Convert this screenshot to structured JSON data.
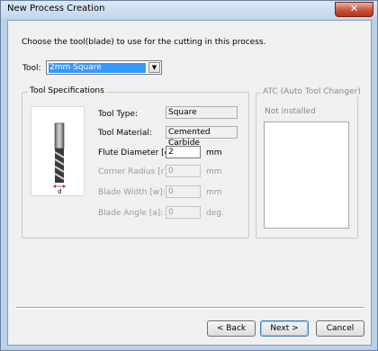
{
  "window": {
    "title": "New Process Creation",
    "close_glyph": "✕"
  },
  "prompt": "Choose the tool(blade) to use for the cutting in this process.",
  "tool": {
    "label": "Tool:",
    "selected": "2mm Square"
  },
  "specs": {
    "group_label": "Tool Specifications",
    "diagram_label": "d",
    "rows": [
      {
        "label": "Tool Type:",
        "value": "Square",
        "unit": ""
      },
      {
        "label": "Tool Material:",
        "value": "Cemented Carbide",
        "unit": ""
      },
      {
        "label": "Flute Diameter [d]:",
        "value": "2",
        "unit": "mm"
      },
      {
        "label": "Corner Radius [r]:",
        "value": "0",
        "unit": "mm"
      },
      {
        "label": "Blade Width [w]:",
        "value": "0",
        "unit": "mm"
      },
      {
        "label": "Blade Angle [a]:",
        "value": "0",
        "unit": "deg."
      }
    ]
  },
  "atc": {
    "group_label": "ATC (Auto Tool Changer)",
    "status": "Not installed"
  },
  "buttons": {
    "back": "< Back",
    "next": "Next >",
    "cancel": "Cancel"
  }
}
